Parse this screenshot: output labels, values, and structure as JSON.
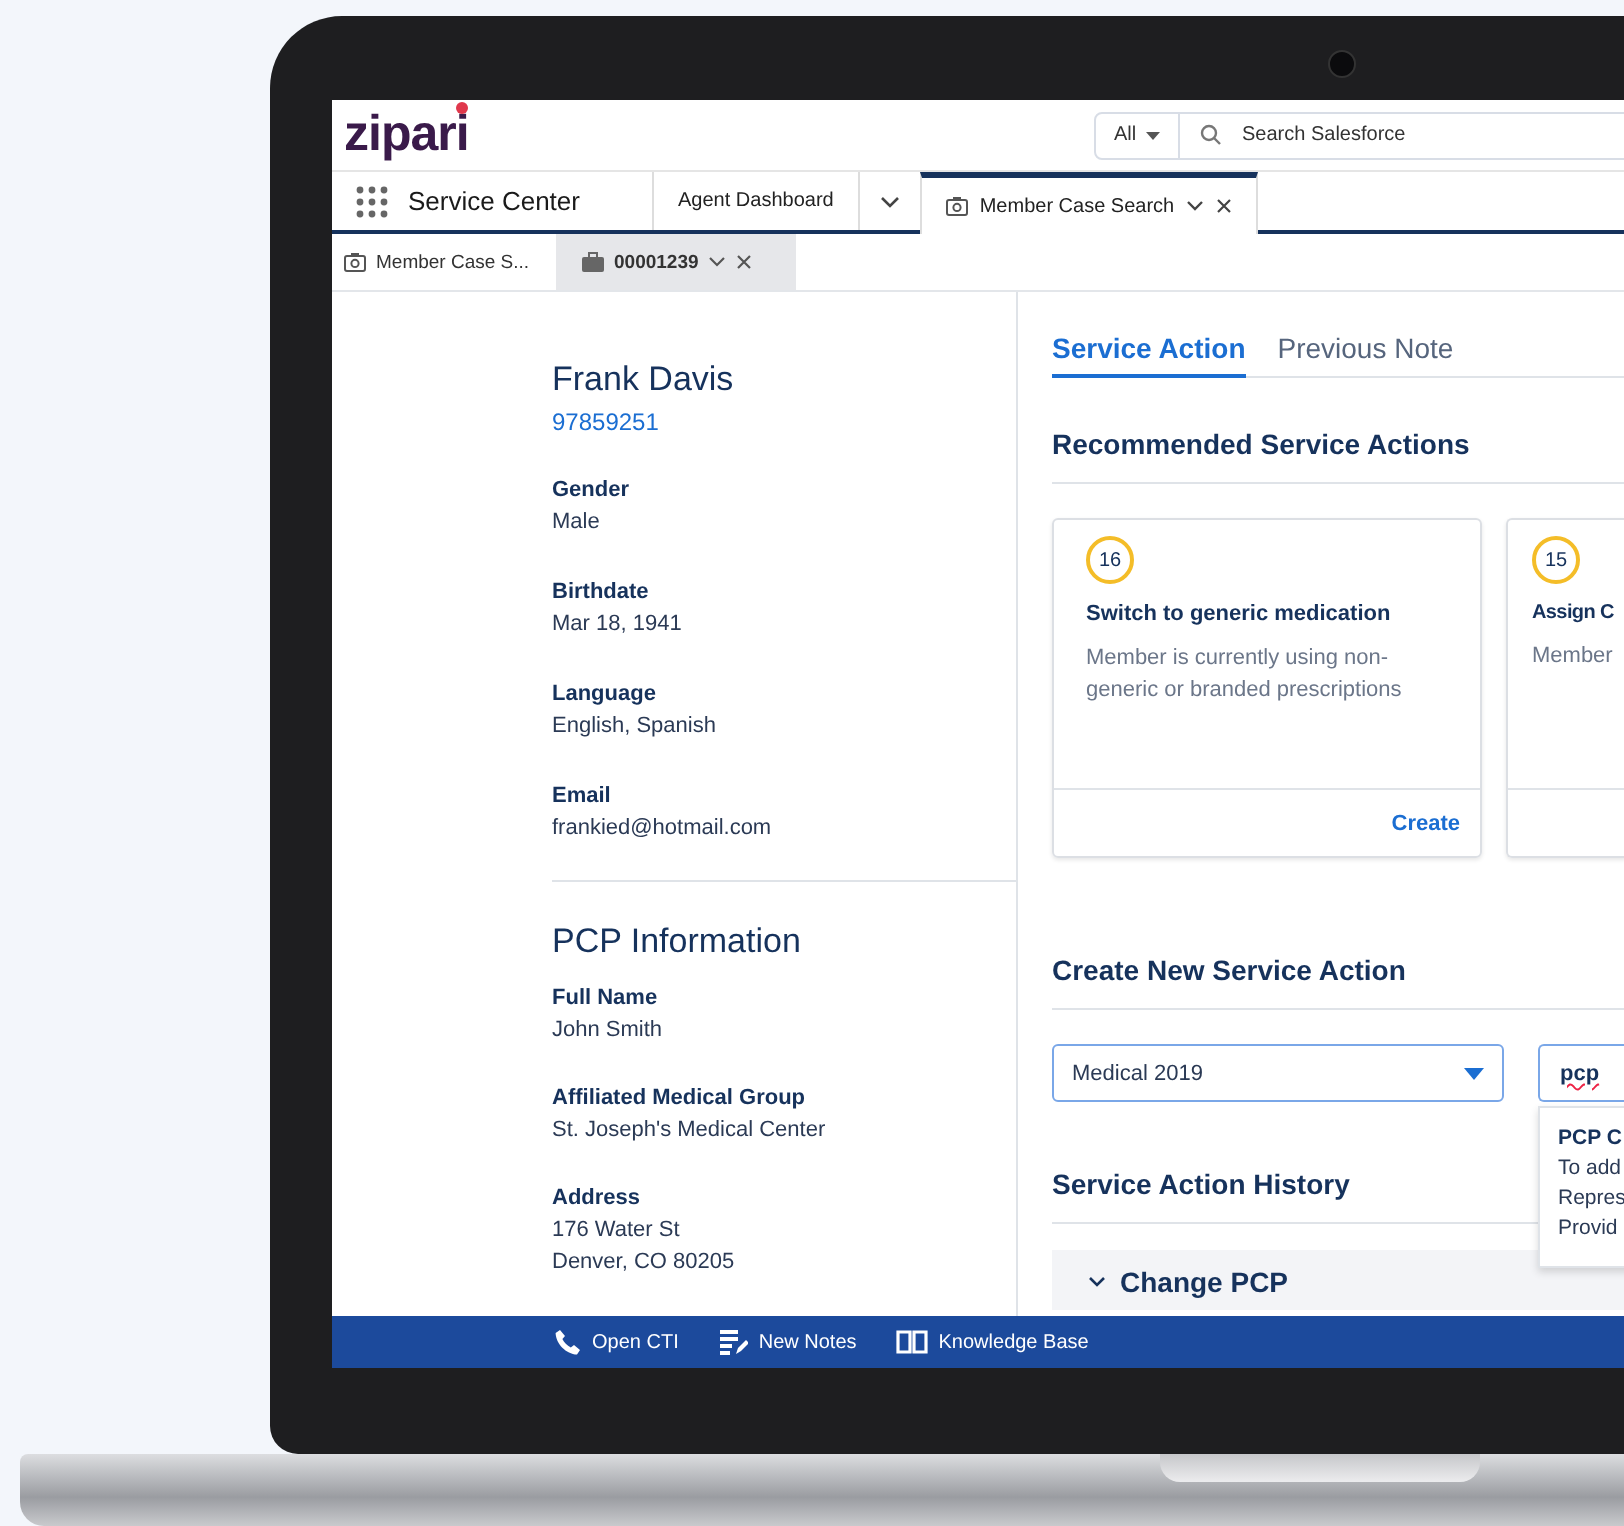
{
  "header": {
    "logo": "zipari",
    "search_scope": "All",
    "search": {
      "placeholder": "Search Salesforce"
    }
  },
  "nav": {
    "app_name": "Service Center",
    "tabs": [
      {
        "label": "Agent Dashboard",
        "kind": "plain",
        "selected": false
      },
      {
        "label": "Member Case Search",
        "kind": "closable",
        "selected": true
      }
    ]
  },
  "subtabs": [
    {
      "label": "Member Case S...",
      "kind": "camera",
      "selected": false
    },
    {
      "label": "00001239",
      "kind": "case",
      "selected": true
    }
  ],
  "member": {
    "name": "Frank Davis",
    "id": "97859251",
    "fields": [
      {
        "label": "Gender",
        "value": "Male"
      },
      {
        "label": "Birthdate",
        "value": "Mar 18, 1941"
      },
      {
        "label": "Language",
        "value": "English, Spanish"
      },
      {
        "label": "Email",
        "value": "frankied@hotmail.com"
      }
    ]
  },
  "pcp": {
    "title": "PCP Information",
    "fields": [
      {
        "label": "Full Name",
        "value": "John Smith"
      },
      {
        "label": "Affiliated Medical Group",
        "value": "St. Joseph's Medical Center"
      },
      {
        "label": "Address",
        "value": "176 Water St\nDenver, CO 80205"
      }
    ]
  },
  "detail_tabs": [
    {
      "label": "Service Action",
      "selected": true
    },
    {
      "label": "Previous Note",
      "selected": false
    }
  ],
  "recommended": {
    "title": "Recommended Service Actions",
    "cards": [
      {
        "score": "16",
        "title": "Switch to generic medication",
        "description": "Member is currently using non-generic or branded prescriptions",
        "action": "Create"
      },
      {
        "score": "15",
        "title": "Assign C",
        "description": "Member"
      }
    ]
  },
  "create": {
    "title": "Create New Service Action",
    "plan_select": "Medical 2019",
    "action_input": "pcp",
    "suggestion": {
      "title": "PCP C",
      "lines": [
        "To add",
        "Repres",
        "Provid"
      ]
    }
  },
  "history": {
    "title": "Service Action History",
    "items": [
      {
        "label": "Change PCP",
        "expanded": true
      }
    ]
  },
  "utility_bar": [
    {
      "label": "Open CTI",
      "kind": "phone"
    },
    {
      "label": "New Notes",
      "kind": "notes"
    },
    {
      "label": "Knowledge Base",
      "kind": "book"
    }
  ]
}
